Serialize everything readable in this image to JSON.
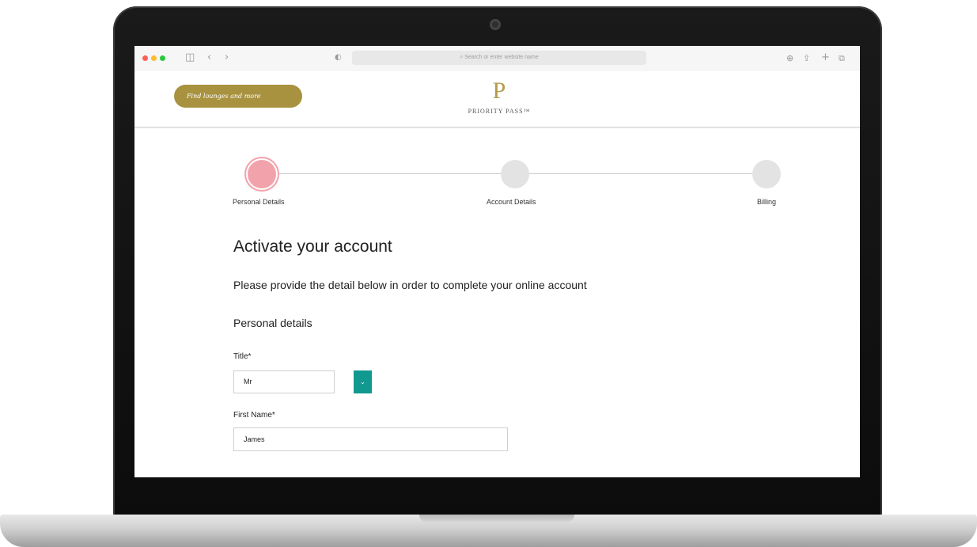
{
  "browser": {
    "address_placeholder": "Search or enter website name",
    "icons": [
      "sidebar-icon",
      "back-icon",
      "forward-icon",
      "privacy-icon",
      "search-icon",
      "download-icon",
      "share-icon",
      "new-tab-icon",
      "tabs-icon"
    ]
  },
  "header": {
    "find_button_label": "Find lounges and more",
    "logo_letter": "P",
    "logo_text": "PRIORITY PASS™"
  },
  "steps": [
    {
      "label": "Personal Details",
      "active": true
    },
    {
      "label": "Account Details",
      "active": false
    },
    {
      "label": "Billing",
      "active": false
    }
  ],
  "page": {
    "title": "Activate your account",
    "intro": "Please provide the detail below in order to complete your online account",
    "section_title": "Personal details"
  },
  "form": {
    "title_label": "Title*",
    "title_value": "Mr",
    "first_name_label": "First Name*",
    "first_name_value": "James"
  },
  "colors": {
    "accent_gold": "#a8923f",
    "step_active": "#f2a2ab",
    "select_button": "#12998f"
  }
}
